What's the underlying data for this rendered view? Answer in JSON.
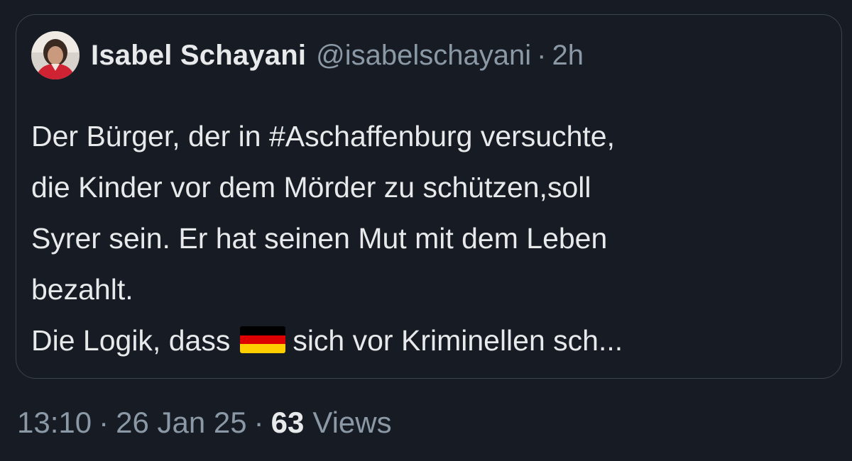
{
  "quoted_tweet": {
    "author_name": "Isabel Schayani",
    "author_handle": "@isabelschayani",
    "separator": "·",
    "relative_time": "2h",
    "text_lines": [
      "Der Bürger, der in #Aschaffenburg versuchte,",
      "die Kinder vor dem Mörder zu schützen,soll",
      "Syrer sein. Er hat seinen Mut mit dem Leben",
      "bezahlt."
    ],
    "last_line_prefix": "Die Logik, dass",
    "flag_icon": "germany-flag-emoji",
    "last_line_suffix": "sich vor Kriminellen  sch..."
  },
  "meta": {
    "time": "13:10",
    "separator": "·",
    "date": "26 Jan 25",
    "views_count": "63",
    "views_label": "Views"
  },
  "colors": {
    "background": "#161b24",
    "card_border": "#3a4350",
    "text_primary": "#e7e9ea",
    "text_secondary": "#8b98a5",
    "flag": [
      "#000000",
      "#dd0000",
      "#ffce00"
    ]
  }
}
